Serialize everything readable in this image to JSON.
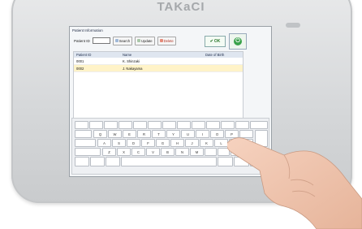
{
  "device": {
    "brand": "TAKaCI"
  },
  "window": {
    "title": "Patient Information"
  },
  "search": {
    "label": "Patient ID",
    "value": ""
  },
  "buttons": {
    "search": "Search",
    "update": "Update",
    "delete": "Delete",
    "ok": "OK"
  },
  "table": {
    "columns": [
      "Patient ID",
      "Name",
      "Date of Birth"
    ],
    "rows": [
      {
        "id": "0001",
        "name": "K. Shinzaki",
        "dob": ""
      },
      {
        "id": "0002",
        "name": "J. Nakayama",
        "dob": ""
      }
    ]
  },
  "keyboard": {
    "row1": [
      "Q",
      "W",
      "E",
      "R",
      "T",
      "Y",
      "U",
      "I",
      "O",
      "P"
    ],
    "row2": [
      "A",
      "S",
      "D",
      "F",
      "G",
      "H",
      "J",
      "K",
      "L"
    ],
    "row3": [
      "Z",
      "X",
      "C",
      "V",
      "B",
      "N",
      "M"
    ]
  },
  "colors": {
    "bezel": "#d6d8da",
    "screen_bg": "#f4f6f8",
    "header_bg": "#dfe6f0",
    "selected_row": "#fff3c8",
    "ok_green": "#2f7a2f"
  }
}
